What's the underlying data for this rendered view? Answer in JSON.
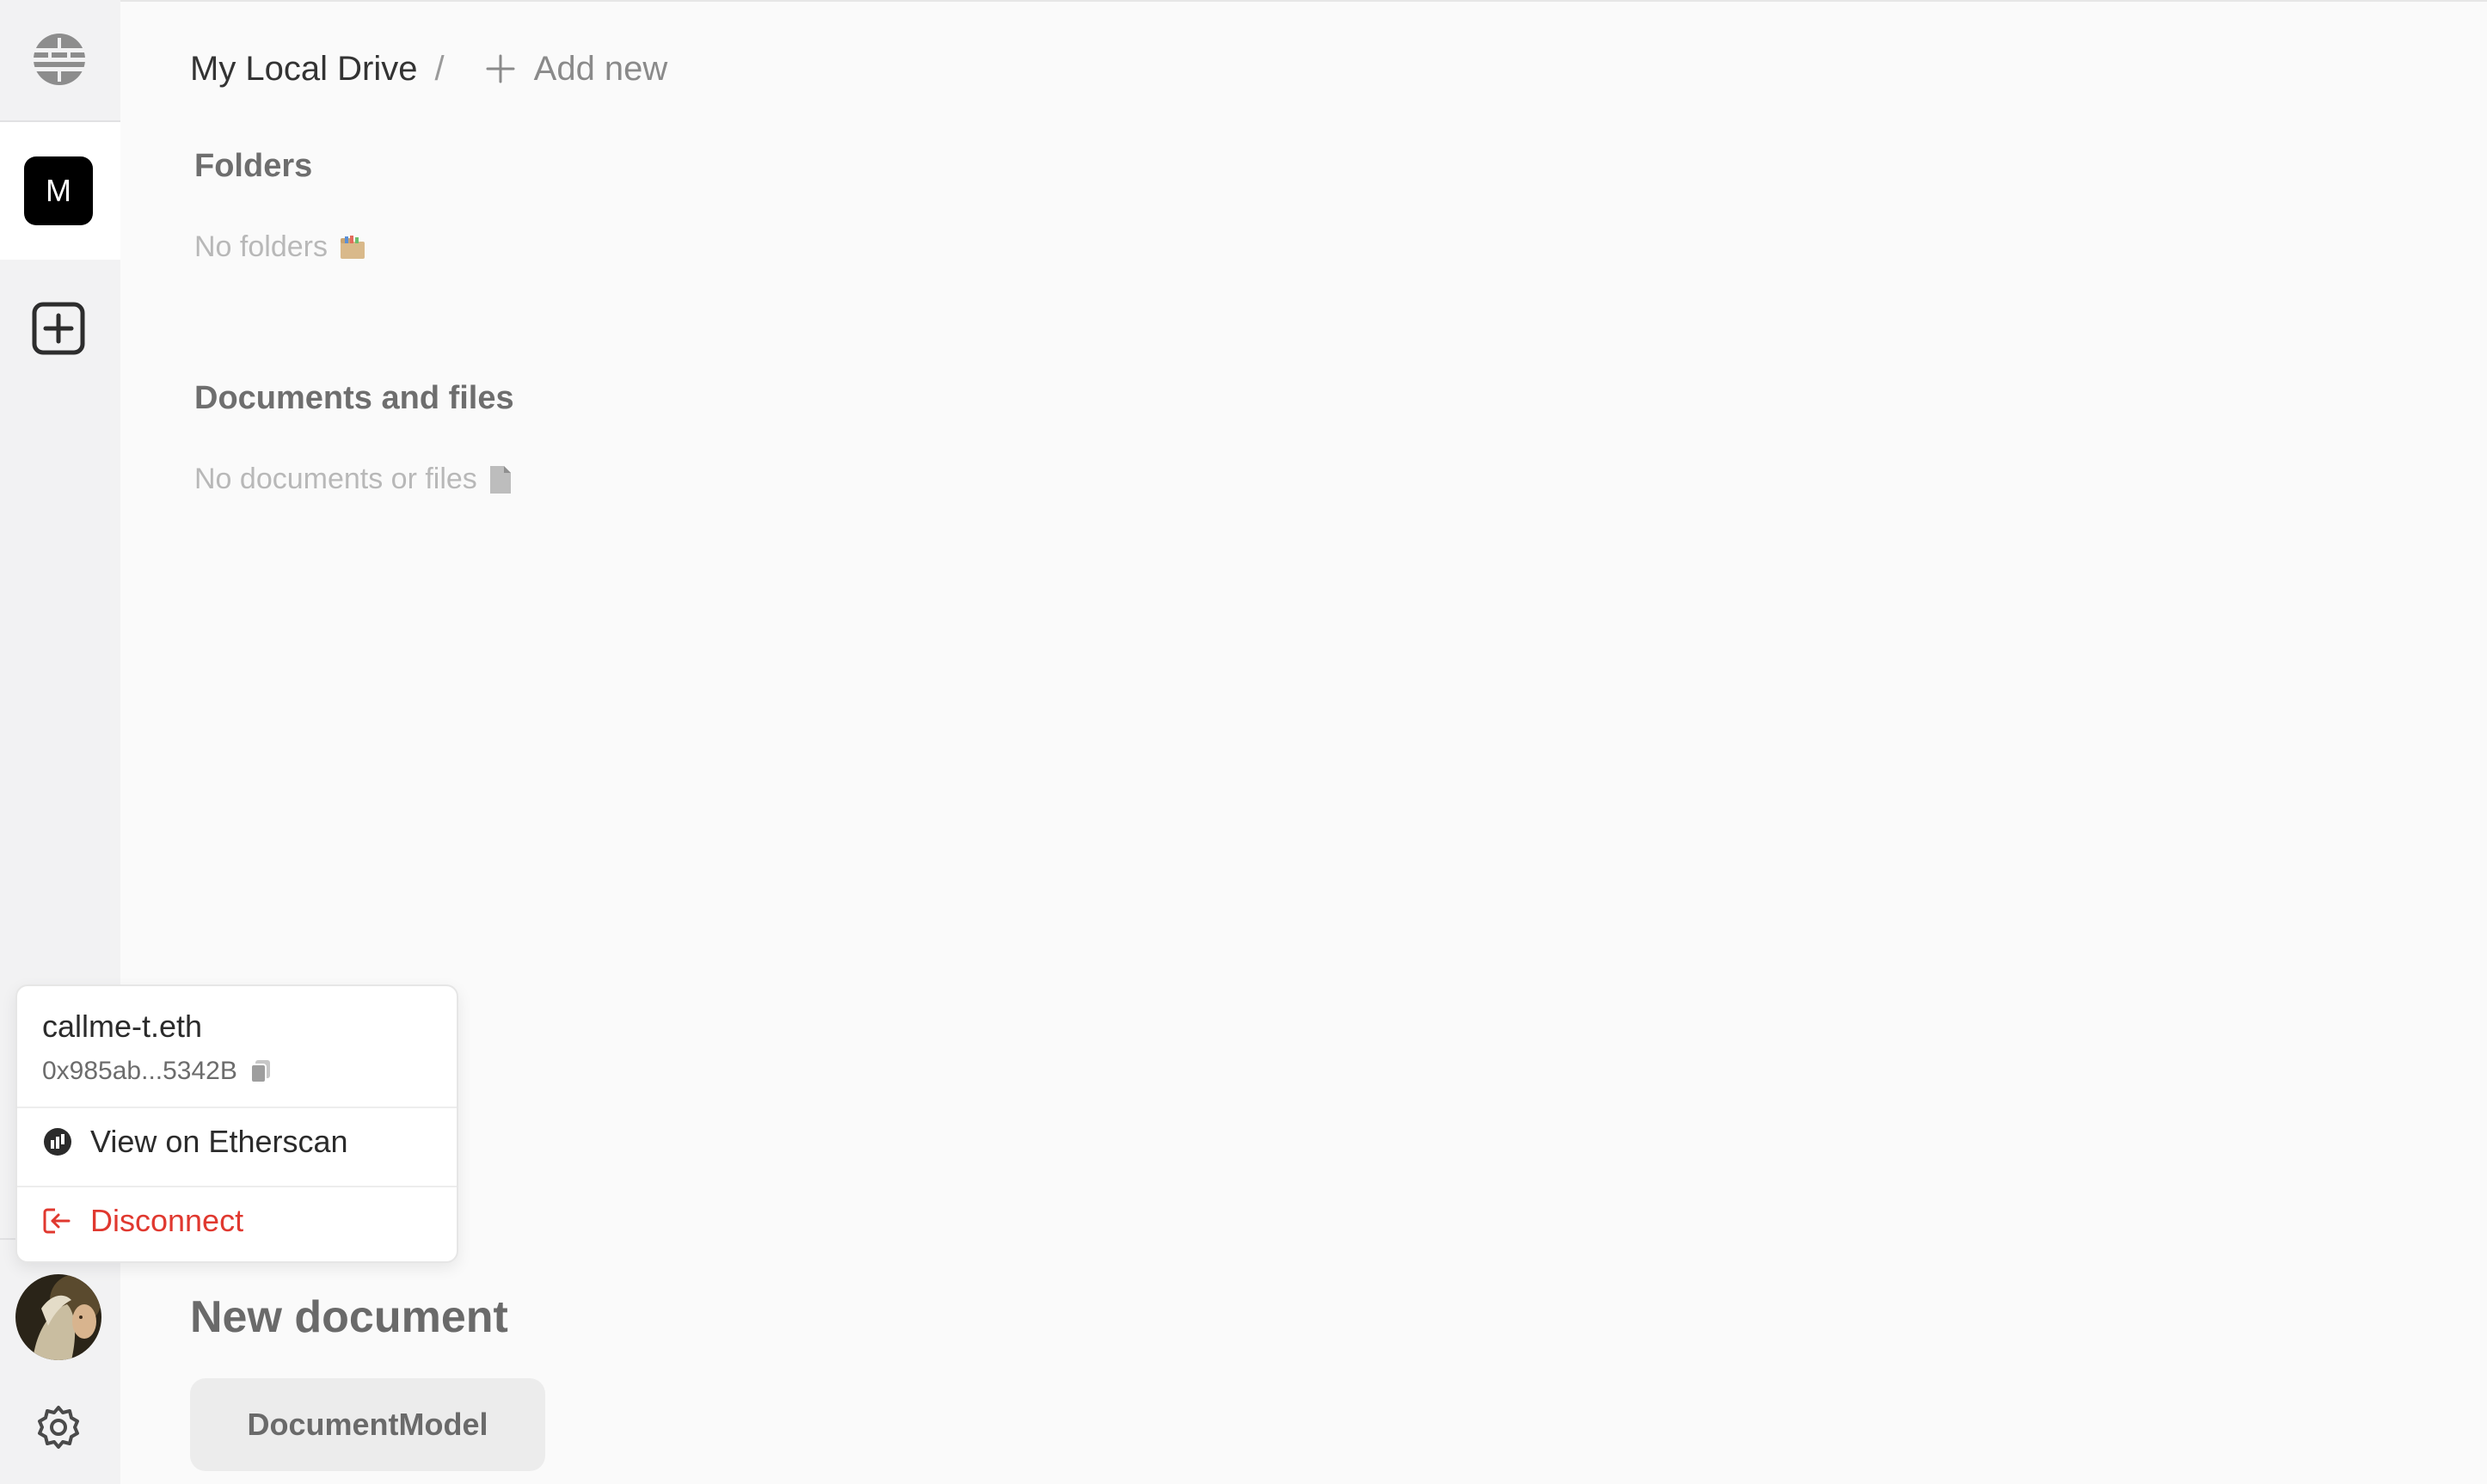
{
  "breadcrumb": {
    "drive": "My Local Drive",
    "separator": "/",
    "add_new": "Add new"
  },
  "sidebar": {
    "drive_badge": "M",
    "icons": [
      "globe-icon",
      "add-drive-icon",
      "settings-icon"
    ]
  },
  "folders": {
    "title": "Folders",
    "empty": "No folders"
  },
  "documents": {
    "title": "Documents and files",
    "empty": "No documents or files"
  },
  "new_document": {
    "title": "New document",
    "types": [
      "DocumentModel"
    ]
  },
  "account_menu": {
    "name": "callme-t.eth",
    "address": "0x985ab...5342B",
    "view_etherscan": "View on Etherscan",
    "disconnect": "Disconnect"
  },
  "colors": {
    "danger": "#e0382f",
    "badge_bg": "#000000",
    "sidebar_bg": "#f2f2f3"
  }
}
